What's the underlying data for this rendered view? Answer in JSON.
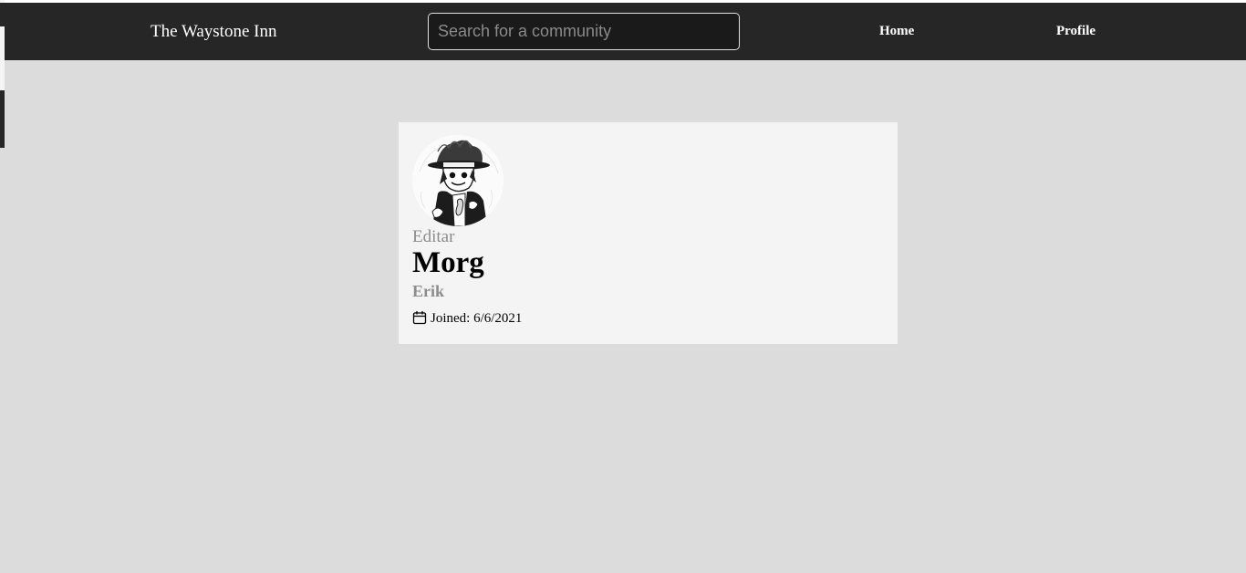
{
  "navbar": {
    "brand": "The Waystone Inn",
    "search_placeholder": "Search for a community",
    "links": {
      "home": "Home",
      "profile": "Profile"
    },
    "background_color": "#262626"
  },
  "profile_card": {
    "avatar_icon": "avatar-illustration",
    "edit_label": "Editar",
    "display_name": "Morg",
    "username": "Erik",
    "joined_icon": "calendar-icon",
    "joined_text": "Joined: 6/6/2021"
  }
}
